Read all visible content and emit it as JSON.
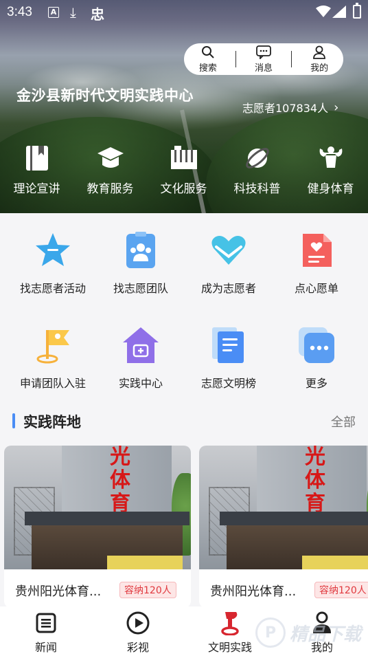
{
  "status_bar": {
    "time": "3:43",
    "a_icon": "A",
    "zhong_glyph": "忠"
  },
  "top_menu": [
    {
      "label": "搜索",
      "icon": "search-icon"
    },
    {
      "label": "消息",
      "icon": "message-icon"
    },
    {
      "label": "我的",
      "icon": "user-icon"
    }
  ],
  "hero": {
    "title": "金沙县新时代文明实践中心",
    "volunteer_count": "志愿者107834人"
  },
  "hero_nav": [
    {
      "label": "理论宣讲",
      "icon": "book-icon"
    },
    {
      "label": "教育服务",
      "icon": "graduation-cap-icon"
    },
    {
      "label": "文化服务",
      "icon": "piano-icon"
    },
    {
      "label": "科技科普",
      "icon": "planet-icon"
    },
    {
      "label": "健身体育",
      "icon": "muscle-icon"
    }
  ],
  "services": [
    {
      "label": "找志愿者活动",
      "icon": "star-icon"
    },
    {
      "label": "找志愿团队",
      "icon": "team-icon"
    },
    {
      "label": "成为志愿者",
      "icon": "heart-hands-icon"
    },
    {
      "label": "点心愿单",
      "icon": "wish-list-icon"
    },
    {
      "label": "申请团队入驻",
      "icon": "flag-icon"
    },
    {
      "label": "实践中心",
      "icon": "house-icon"
    },
    {
      "label": "志愿文明榜",
      "icon": "document-icon"
    },
    {
      "label": "更多",
      "icon": "more-icon"
    }
  ],
  "section": {
    "title": "实践阵地",
    "all_label": "全部"
  },
  "cards": [
    {
      "title": "贵州阳光体育...",
      "badge": "容纳120人",
      "sign_text": "光体育"
    },
    {
      "title": "贵州阳光体育...",
      "badge": "容纳120人",
      "sign_text": "光体育"
    }
  ],
  "tabs": [
    {
      "label": "新闻",
      "icon": "news-icon"
    },
    {
      "label": "彩视",
      "icon": "play-icon"
    },
    {
      "label": "文明实践",
      "icon": "civilization-icon",
      "active": true
    },
    {
      "label": "我的",
      "icon": "user-icon"
    }
  ],
  "watermark": {
    "text": "精品下载",
    "glyph": "P"
  },
  "colors": {
    "accent_blue": "#4a8df5",
    "badge_red": "#e0383e",
    "active_tab_red": "#d7262f"
  }
}
